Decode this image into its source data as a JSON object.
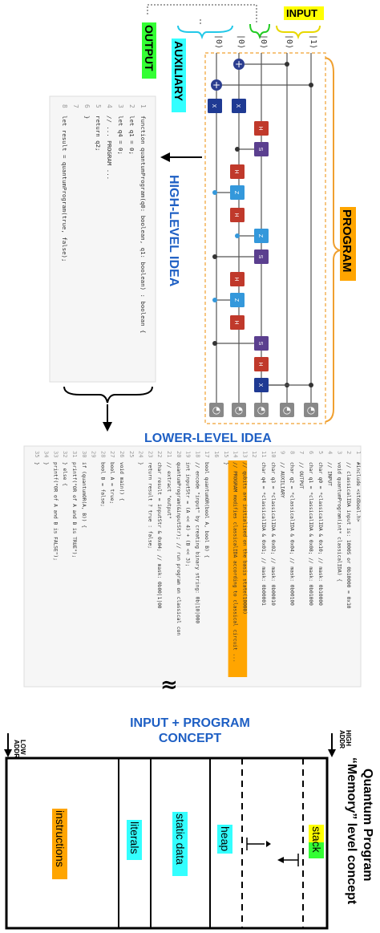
{
  "labels": {
    "input": "INPUT",
    "output": "OUTPUT",
    "auxiliary": "AUXILIARY",
    "program": "PROGRAM",
    "high_level_idea": "HIGH-LEVEL IDEA",
    "lower_level_idea": "LOWER-LEVEL IDEA",
    "input_program_concept_1": "INPUT + PROGRAM",
    "input_program_concept_2": "CONCEPT",
    "quantum_program_1": "Quantum Program",
    "quantum_program_2": "“Memory” level concept",
    "low_addr_1": "LOW",
    "low_addr_2": "ADDR",
    "high_addr_1": "HIGH",
    "high_addr_2": "ADDR",
    "approx": "≈"
  },
  "circuit": {
    "qubit_labels": [
      "|0⟩",
      "|0⟩",
      "|0⟩",
      "|0⟩",
      "|1⟩"
    ],
    "gate_letters": {
      "x": "X",
      "h": "H",
      "s": "S",
      "z": "Z"
    },
    "measure_symbol": "◔",
    "plus_symbol": "+"
  },
  "high_level_code": {
    "line_numbers": [
      "1",
      "2",
      "3",
      "4",
      "5",
      "6",
      "7",
      "8"
    ],
    "lines": [
      "function quantumProgram(q0: boolean, q1: boolean) : boolean {",
      "  let q1 = 0;",
      "  let q4 = 0;",
      "  // ... PROGRAM ...",
      "  return q2;",
      "}",
      "",
      "let result = quantumProgram(true, false);"
    ]
  },
  "lower_level_code": {
    "line_numbers": [
      "1",
      "2",
      "3",
      "4",
      "5",
      "6",
      "7",
      "8",
      "9",
      "10",
      "11",
      "12",
      "13",
      "14",
      "15",
      "16",
      "17",
      "18",
      "19",
      "20",
      "21",
      "22",
      "23",
      "24",
      "25",
      "26",
      "27",
      "28",
      "29",
      "30",
      "31",
      "32",
      "33",
      "34",
      "35"
    ],
    "lines": [
      "#include <stdbool.h>",
      "// classicalIDA input is: 1000S or 0b10000 = 0x10",
      "void quantumProgram(int* classicalIDA) {",
      "  // INPUT",
      "  char q0 = *classicalIDA & 0x10; // mask: 0b10000",
      "  char q1 = *classicalIDA & 0x08; // mask: 0b01000",
      "  // OUTPUT",
      "  char q2 = *classicalIDA & 0x04; // mask: 0b00100",
      "  // AUXILIARY",
      "  char q3 = *classicalIDA & 0x02; // mask: 0b00010",
      "  char q4 = *classicalIDA & 0x01; // mask: 0b00001",
      "",
      "  // qubits are initialised on the basis state(10000)",
      "  // PROGRAM modifies classicalIDA according to classical circuit ...",
      "}",
      "",
      "bool quantumOR(bool A, bool B) {",
      "  // encode \"input\" by creating binary string: 0b|10|000",
      "  int inputStr = (A << 4) + (B << 3);",
      "  quantumProgram(&inputStr); // run program on classical con",
      "  // extract \"output\"",
      "  char result = inputStr & 0x04; // mask: 0b00|1|00",
      "  return result ? true : false;",
      "}",
      "",
      "void main() {",
      "  bool A = true;",
      "  bool B = false;",
      "",
      "  if (quantumOR(A, B)) {",
      "    printf(\"OR of A and B is TRUE\");",
      "  } else {",
      "    printf(\"OR of A and B is FALSE\");",
      "  }",
      "}"
    ]
  },
  "memory": {
    "stack": "stack",
    "heap": "heap",
    "static_data": "static data",
    "literals": "literals",
    "instructions": "instructions"
  },
  "colors": {
    "h_gate": "#c0392b",
    "z_gate": "#3498db",
    "s_gate": "#5b3f8f",
    "x_gate": "#1f3a93",
    "plus_gate": "#2c3e90",
    "program_border": "#f0a030",
    "input_yellow": "#ffff00",
    "output_green": "#33ff33",
    "aux_cyan": "#33ffff",
    "program_orange": "#ffa500",
    "title_blue": "#1e5fc4"
  }
}
